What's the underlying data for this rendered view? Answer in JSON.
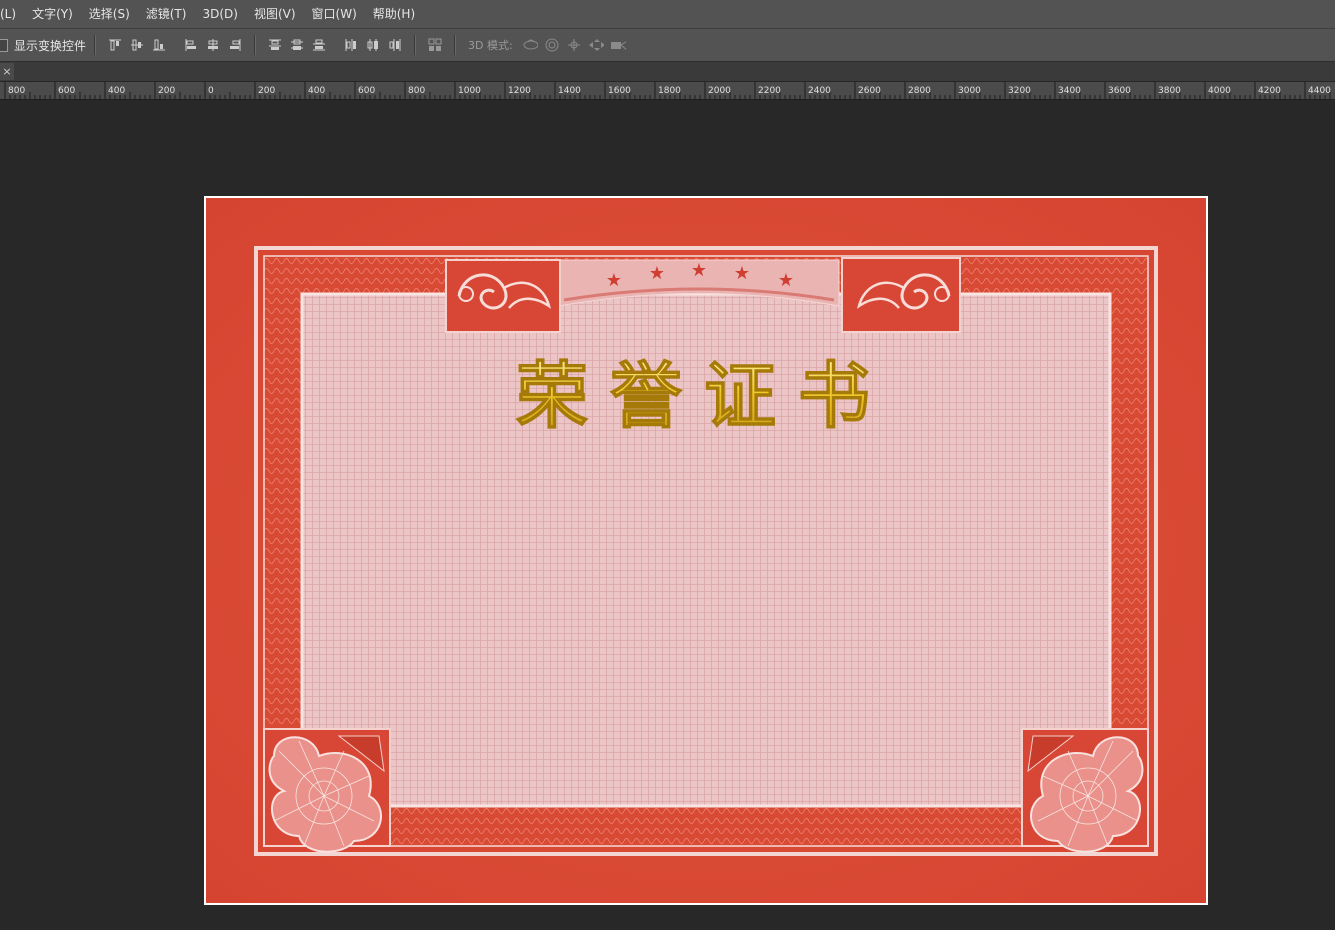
{
  "menubar": {
    "items": [
      "(L)",
      "文字(Y)",
      "选择(S)",
      "滤镜(T)",
      "3D(D)",
      "视图(V)",
      "窗口(W)",
      "帮助(H)"
    ]
  },
  "optionsbar": {
    "show_transform_controls": "显示变换控件",
    "mode_label": "3D 模式:",
    "show_transform_checked": false
  },
  "tabstrip": {
    "close_glyph": "×"
  },
  "ruler": {
    "labels": [
      "800",
      "600",
      "400",
      "200",
      "0",
      "200",
      "400",
      "600",
      "800",
      "1000",
      "1200",
      "1400",
      "1600",
      "1800",
      "2000",
      "2200",
      "2400",
      "2600",
      "2800",
      "3000",
      "3200",
      "3400",
      "3600",
      "3800",
      "4000",
      "4200",
      "4400"
    ]
  },
  "document": {
    "title_text": "荣誉证书",
    "colors": {
      "border_red": "#d84a34",
      "panel_pink": "#ecc7c7",
      "gold": "#f2cf3a"
    }
  },
  "icons": {
    "align_group_1": [
      "align-top-edges-icon",
      "align-vertical-centers-icon",
      "align-bottom-edges-icon"
    ],
    "align_group_2": [
      "align-left-edges-icon",
      "align-horizontal-centers-icon",
      "align-right-edges-icon"
    ],
    "distribute_group_1": [
      "distribute-top-icon",
      "distribute-vertical-centers-icon",
      "distribute-bottom-icon"
    ],
    "distribute_group_2": [
      "distribute-left-icon",
      "distribute-horizontal-centers-icon",
      "distribute-right-icon"
    ],
    "auto_align": "auto-align-icon",
    "three_d_modes": [
      "rotate-3d-icon",
      "roll-3d-icon",
      "drag-3d-icon",
      "slide-3d-icon",
      "scale-3d-camera-icon"
    ]
  }
}
